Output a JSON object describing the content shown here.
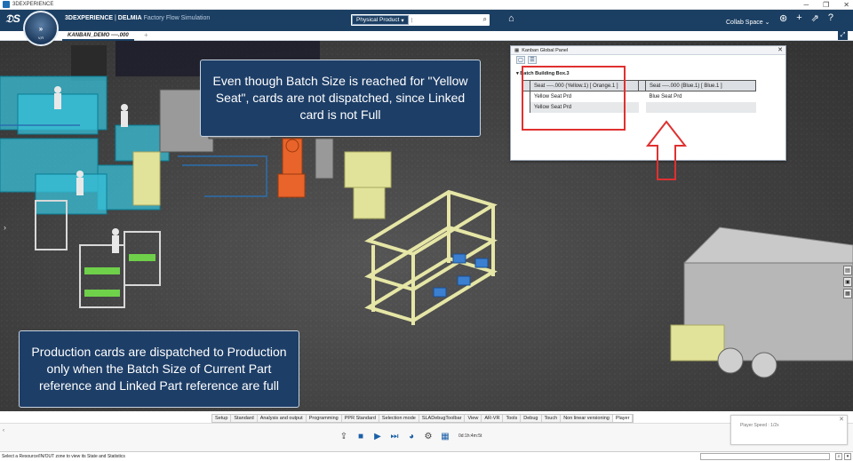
{
  "window": {
    "title": "3DEXPERIENCE",
    "minimize": "─",
    "restore": "❐",
    "close": "✕"
  },
  "header": {
    "ds_logo": "𝔇S",
    "compass_label": "V,R",
    "compass_symbol": "»",
    "brand_prefix": "3DEXPERIENCE",
    "brand_separator": " | ",
    "brand_name": "DELMIA",
    "app_name": " Factory Flow Simulation",
    "search_scope": "Physical Product",
    "search_placeholder": "|",
    "collab_space": "Collab Space",
    "chevron": "⌄",
    "icons": [
      "user-icon",
      "add-icon",
      "share-icon",
      "help-icon"
    ],
    "icon_glyphs": [
      "⊛",
      "+",
      "⇗",
      "?"
    ]
  },
  "tabs": {
    "active": "KANBAN_DEMO ----.000",
    "add": "+"
  },
  "callouts": {
    "top": "Even though Batch Size is reached for \"Yellow Seat\", cards are not dispatched, since Linked card is not Full",
    "bottom": "Production cards are dispatched to Production only when the Batch Size of Current Part reference and Linked Part reference are full"
  },
  "kanban_panel": {
    "title": "Kanban Global Panel",
    "close": "✕",
    "group": "Batch Building Box.3",
    "headers": [
      "Seat ----.000 (Yellow.1) [ Orange.1 ]",
      "Seat ----.000 (Blue.1) [ Blue.1 ]"
    ],
    "rows": [
      [
        "Yellow Seat Prd",
        "Blue Seat Prd"
      ],
      [
        "Yellow Seat Prd",
        ""
      ]
    ]
  },
  "bottom_tabs": [
    "Setup",
    "Standard",
    "Analysis and output",
    "Programming",
    "PPR Standard",
    "Selection mode",
    "SLADebugToolbar",
    "View",
    "AR-VR",
    "Tools",
    "Debug",
    "Touch",
    "Non linear versioning",
    "Player"
  ],
  "player": {
    "time": "0d:1h:4m:5t",
    "speed": "Player Speed : 1/2x",
    "speed_close": "✕"
  },
  "status": {
    "message": "Select a Resource/IN/OUT zone to view its State and Statistics"
  },
  "colors": {
    "header_bg": "#1b3f63",
    "callout_bg": "#1d3e67",
    "highlight_red": "#e03030",
    "player_blue": "#1b5fa8"
  }
}
